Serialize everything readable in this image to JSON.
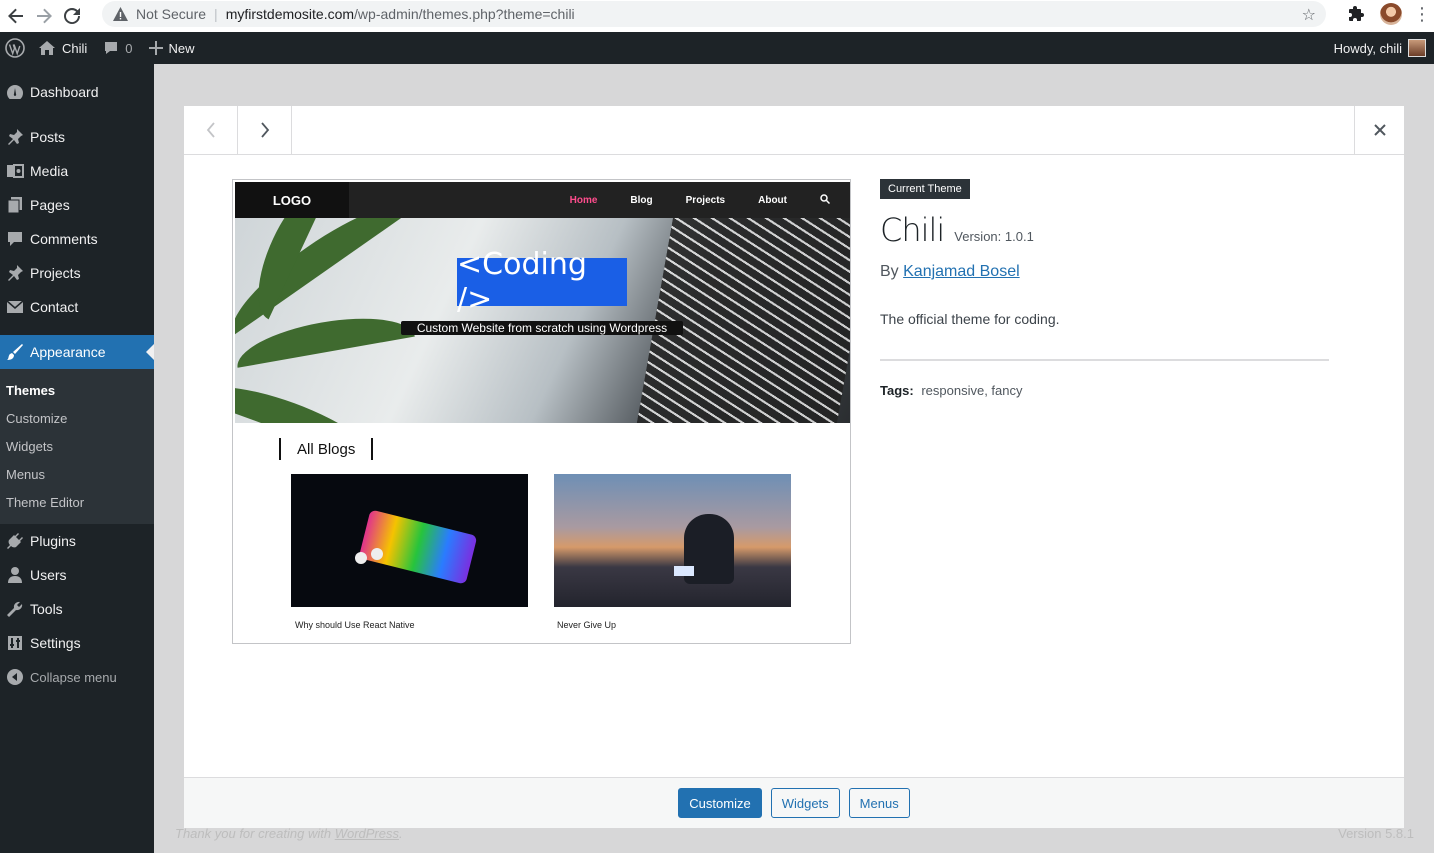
{
  "browser": {
    "security_label": "Not Secure",
    "url_host": "myfirstdemosite.com",
    "url_path": "/wp-admin/themes.php?theme=chili"
  },
  "adminbar": {
    "site_name": "Chili",
    "comments_count": "0",
    "new_label": "New",
    "howdy": "Howdy, chili"
  },
  "sidebar": {
    "items_top": [
      {
        "label": "Dashboard",
        "icon": "dashboard-icon"
      }
    ],
    "items_mid": [
      {
        "label": "Posts",
        "icon": "pin-icon"
      },
      {
        "label": "Media",
        "icon": "media-icon"
      },
      {
        "label": "Pages",
        "icon": "pages-icon"
      },
      {
        "label": "Comments",
        "icon": "comment-icon"
      },
      {
        "label": "Projects",
        "icon": "pin-icon"
      },
      {
        "label": "Contact",
        "icon": "mail-icon"
      }
    ],
    "current": {
      "label": "Appearance",
      "icon": "brush-icon"
    },
    "submenu": [
      "Themes",
      "Customize",
      "Widgets",
      "Menus",
      "Theme Editor"
    ],
    "items_bottom": [
      {
        "label": "Plugins",
        "icon": "plugin-icon"
      },
      {
        "label": "Users",
        "icon": "users-icon"
      },
      {
        "label": "Tools",
        "icon": "wrench-icon"
      },
      {
        "label": "Settings",
        "icon": "settings-icon"
      }
    ],
    "collapse_label": "Collapse menu"
  },
  "screenshot": {
    "logo": "LOGO",
    "nav": [
      "Home",
      "Blog",
      "Projects",
      "About"
    ],
    "hero_title": "<Coding />",
    "hero_subtitle": "Custom Website from scratch using Wordpress",
    "section_title": "All Blogs",
    "posts": [
      "Why should Use React Native",
      "Never Give Up"
    ]
  },
  "theme": {
    "badge": "Current Theme",
    "name": "Chili",
    "version": "Version: 1.0.1",
    "by": "By ",
    "author": "Kanjamad Bosel",
    "description": "The official theme for coding.",
    "tags_label": "Tags:",
    "tags": "responsive, fancy"
  },
  "actions": {
    "customize": "Customize",
    "widgets": "Widgets",
    "menus": "Menus"
  },
  "footer": {
    "thanks": "Thank you for creating with ",
    "thanks_link": "WordPress",
    "thanks_end": ".",
    "version": "Version 5.8.1"
  },
  "colors": {
    "admin_dark": "#1d2327",
    "accent": "#2271b1",
    "hero_title_bg": "#1a5fe6",
    "nav_active": "#ff4d8d"
  }
}
